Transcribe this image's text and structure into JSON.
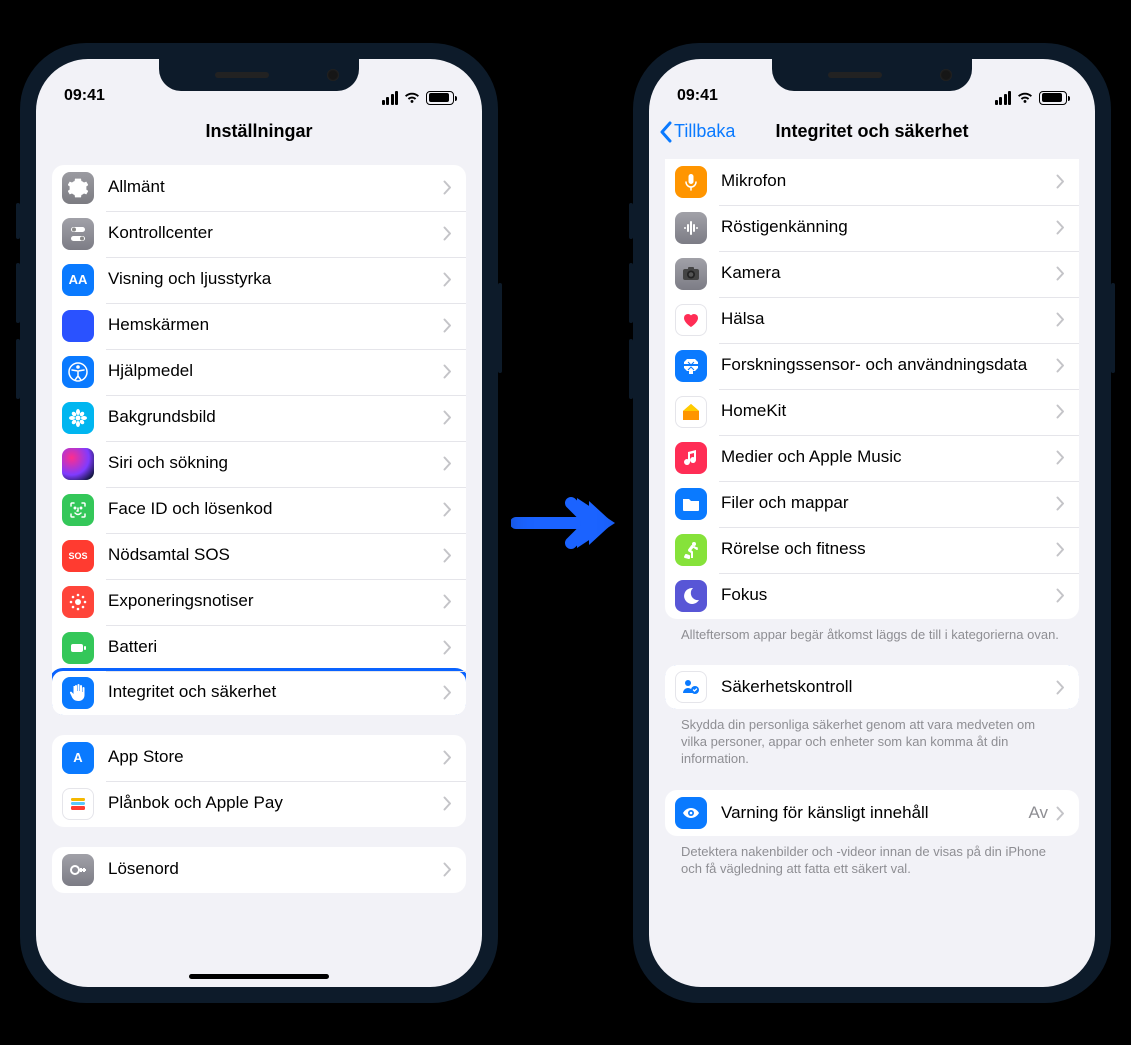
{
  "status": {
    "time": "09:41"
  },
  "left": {
    "title": "Inställningar",
    "group1": [
      {
        "key": "allmant",
        "label": "Allmänt",
        "icon": "gear-icon",
        "cls": "ic-gray"
      },
      {
        "key": "kontrollcenter",
        "label": "Kontrollcenter",
        "icon": "toggles-icon",
        "cls": "ic-darkgray"
      },
      {
        "key": "visning",
        "label": "Visning och ljusstyrka",
        "icon": "aa-icon",
        "cls": "ic-blue",
        "glyph": "AA"
      },
      {
        "key": "hemskarmen",
        "label": "Hemskärmen",
        "icon": "apps-icon",
        "cls": "ic-apps apps"
      },
      {
        "key": "hjalpmedel",
        "label": "Hjälpmedel",
        "icon": "accessibility-icon",
        "cls": "ic-blue"
      },
      {
        "key": "bakgrundsbild",
        "label": "Bakgrundsbild",
        "icon": "flower-icon",
        "cls": "ic-cyan"
      },
      {
        "key": "siri",
        "label": "Siri och sökning",
        "icon": "siri-icon",
        "cls": "ic-siri"
      },
      {
        "key": "faceid",
        "label": "Face ID och lösenkod",
        "icon": "faceid-icon",
        "cls": "ic-green"
      },
      {
        "key": "nodsamtal",
        "label": "Nödsamtal SOS",
        "icon": "sos-icon",
        "cls": "ic-red",
        "glyph": "SOS"
      },
      {
        "key": "exponering",
        "label": "Exponeringsnotiser",
        "icon": "exposure-icon",
        "cls": "ic-redd"
      },
      {
        "key": "batteri",
        "label": "Batteri",
        "icon": "battery-icon",
        "cls": "ic-green"
      },
      {
        "key": "integritet",
        "label": "Integritet och säkerhet",
        "icon": "hand-icon",
        "cls": "ic-blue",
        "highlight": true
      }
    ],
    "group2": [
      {
        "key": "appstore",
        "label": "App Store",
        "icon": "appstore-icon",
        "cls": "ic-blue",
        "glyph": "A"
      },
      {
        "key": "planbok",
        "label": "Plånbok och Apple Pay",
        "icon": "wallet-icon",
        "cls": "ic-white"
      }
    ],
    "group3": [
      {
        "key": "losenord",
        "label": "Lösenord",
        "icon": "key-icon",
        "cls": "ic-key"
      }
    ]
  },
  "right": {
    "back": "Tillbaka",
    "title": "Integritet och säkerhet",
    "group1": [
      {
        "key": "mikrofon",
        "label": "Mikrofon",
        "icon": "microphone-icon",
        "cls": "ic-orange"
      },
      {
        "key": "rostigenkanning",
        "label": "Röstigenkänning",
        "icon": "voice-icon",
        "cls": "ic-darkgray"
      },
      {
        "key": "kamera",
        "label": "Kamera",
        "icon": "camera-icon",
        "cls": "ic-darkgray"
      },
      {
        "key": "halsa",
        "label": "Hälsa",
        "icon": "heart-icon",
        "cls": "ic-white"
      },
      {
        "key": "forskningssensor",
        "label": "Forskningssensor- och användningsdata",
        "icon": "research-icon",
        "cls": "ic-blue"
      },
      {
        "key": "homekit",
        "label": "HomeKit",
        "icon": "home-icon",
        "cls": "ic-white"
      },
      {
        "key": "medier",
        "label": "Medier och Apple Music",
        "icon": "music-icon",
        "cls": "ic-pink"
      },
      {
        "key": "filer",
        "label": "Filer och mappar",
        "icon": "folder-icon",
        "cls": "ic-folder"
      },
      {
        "key": "rorelse",
        "label": "Rörelse och fitness",
        "icon": "fitness-icon",
        "cls": "ic-lime"
      },
      {
        "key": "fokus",
        "label": "Fokus",
        "icon": "moon-icon",
        "cls": "ic-indigo"
      }
    ],
    "caption1": "Allteftersom appar begär åtkomst läggs de till i kategorierna ovan.",
    "group2": [
      {
        "key": "sakerhetskontroll",
        "label": "Säkerhetskontroll",
        "icon": "safety-check-icon",
        "cls": "ic-white",
        "highlight": true
      }
    ],
    "caption2": "Skydda din personliga säkerhet genom att vara medveten om vilka personer, appar och enheter som kan komma åt din information.",
    "group3": [
      {
        "key": "varning",
        "label": "Varning för känsligt innehåll",
        "value": "Av",
        "icon": "eye-icon",
        "cls": "ic-blue"
      }
    ],
    "caption3": "Detektera nakenbilder och -videor innan de visas på din iPhone och få vägledning att fatta ett säkert val."
  }
}
